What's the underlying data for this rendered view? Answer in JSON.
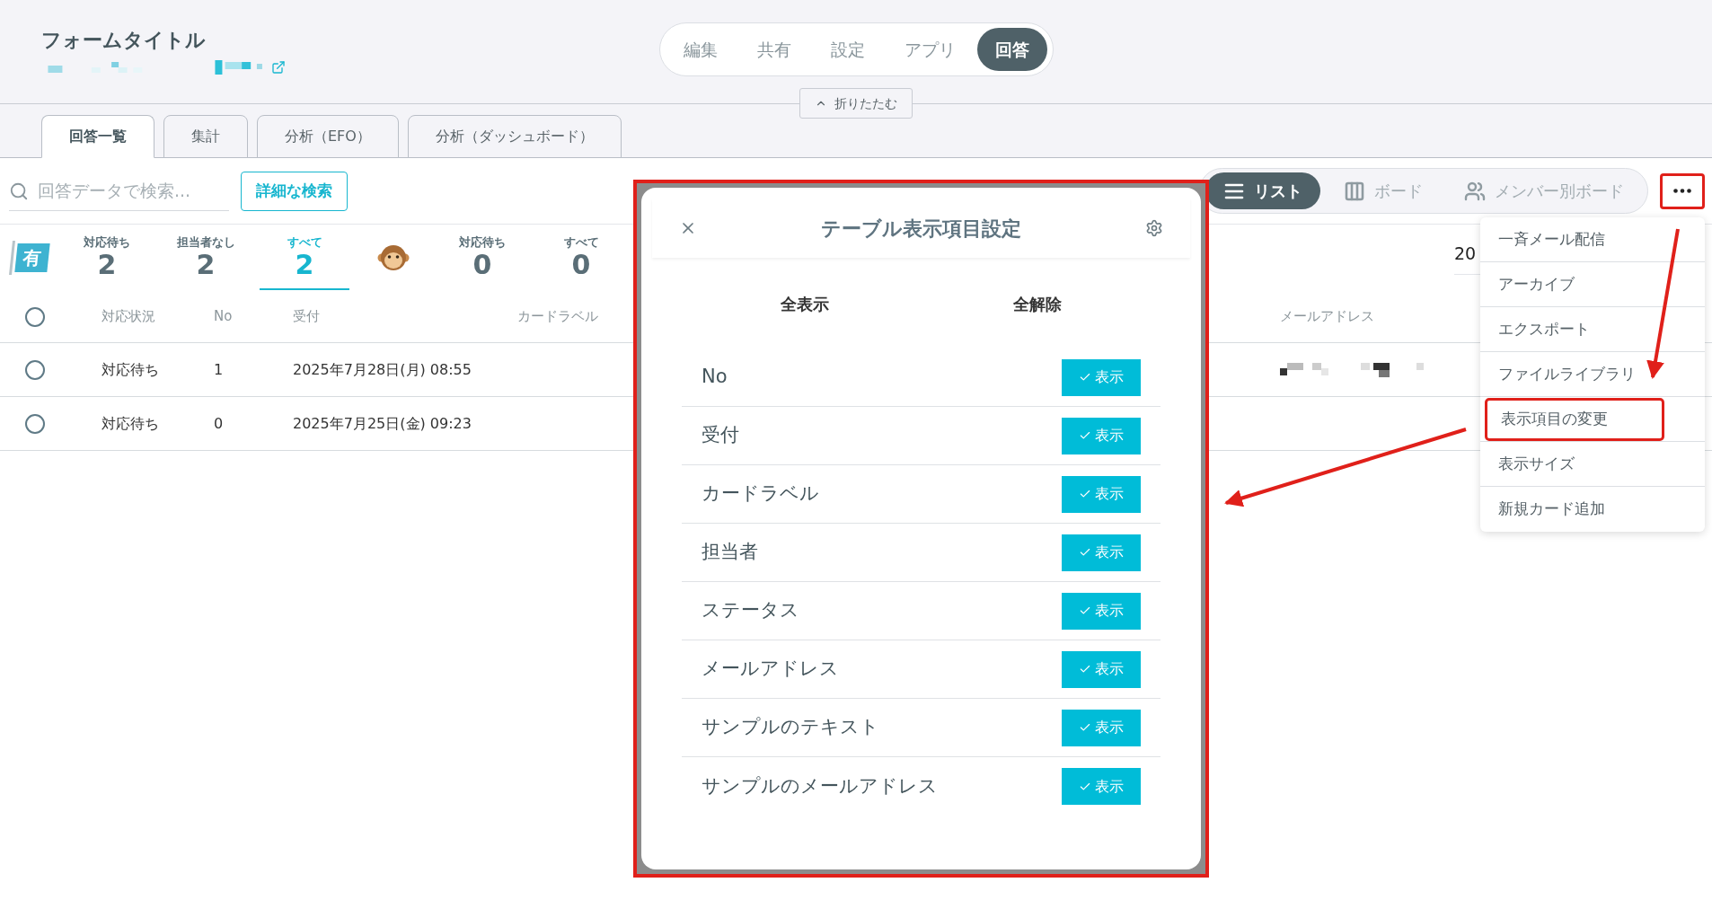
{
  "header": {
    "title": "フォームタイトル",
    "url_masked": true,
    "nav": [
      {
        "label": "編集",
        "selected": false
      },
      {
        "label": "共有",
        "selected": false
      },
      {
        "label": "設定",
        "selected": false
      },
      {
        "label": "アプリ",
        "selected": false
      },
      {
        "label": "回答",
        "selected": true
      }
    ],
    "collapse_button": "折りたたむ"
  },
  "tabs": [
    {
      "label": "回答一覧",
      "selected": true
    },
    {
      "label": "集計",
      "selected": false
    },
    {
      "label": "分析（EFO）",
      "selected": false
    },
    {
      "label": "分析（ダッシュボード）",
      "selected": false
    }
  ],
  "search": {
    "placeholder": "回答データで検索...",
    "advanced_button": "詳細な検索"
  },
  "view_modes": [
    {
      "kind": "list",
      "label": "リスト",
      "selected": true
    },
    {
      "kind": "board",
      "label": "ボード",
      "selected": false
    },
    {
      "kind": "members",
      "label": "メンバー別ボード",
      "selected": false
    }
  ],
  "stats": [
    {
      "kind": "flag",
      "text": "有"
    },
    {
      "kind": "counter",
      "label": "対応待ち",
      "value": "2",
      "selected": false
    },
    {
      "kind": "counter",
      "label": "担当者なし",
      "value": "2",
      "selected": false
    },
    {
      "kind": "counter",
      "label": "すべて",
      "value": "2",
      "selected": true
    },
    {
      "kind": "monkey"
    },
    {
      "kind": "counter",
      "label": "対応待ち",
      "value": "0",
      "selected": false
    },
    {
      "kind": "counter",
      "label": "すべて",
      "value": "0",
      "selected": false
    }
  ],
  "page_size": "20",
  "table": {
    "select_all": false,
    "columns": [
      "対応状況",
      "No",
      "受付",
      "カードラベル",
      "メールアドレス"
    ],
    "rows": [
      {
        "selected": false,
        "cells": [
          "対応待ち",
          "1",
          "2025年7月28日(月) 08:55"
        ],
        "email_masked": true
      },
      {
        "selected": false,
        "cells": [
          "対応待ち",
          "0",
          "2025年7月25日(金) 09:23"
        ],
        "email_masked": false
      }
    ]
  },
  "modal": {
    "title": "テーブル表示項目設定",
    "show_all": "全表示",
    "hide_all": "全解除",
    "items": [
      {
        "label": "No",
        "button": "表示",
        "on": true
      },
      {
        "label": "受付",
        "button": "表示",
        "on": true
      },
      {
        "label": "カードラベル",
        "button": "表示",
        "on": true
      },
      {
        "label": "担当者",
        "button": "表示",
        "on": true
      },
      {
        "label": "ステータス",
        "button": "表示",
        "on": true
      },
      {
        "label": "メールアドレス",
        "button": "表示",
        "on": true
      },
      {
        "label": "サンプルのテキスト",
        "button": "表示",
        "on": true
      },
      {
        "label": "サンプルのメールアドレス",
        "button": "表示",
        "on": true
      }
    ]
  },
  "menu": {
    "items": [
      {
        "label": "一斉メール配信",
        "annotated": false
      },
      {
        "label": "アーカイブ",
        "annotated": false
      },
      {
        "label": "エクスポート",
        "annotated": false
      },
      {
        "label": "ファイルライブラリ",
        "annotated": false
      },
      {
        "label": "表示項目の変更",
        "annotated": true
      },
      {
        "label": "表示サイズ",
        "annotated": false
      },
      {
        "label": "新規カード追加",
        "annotated": false
      }
    ]
  }
}
